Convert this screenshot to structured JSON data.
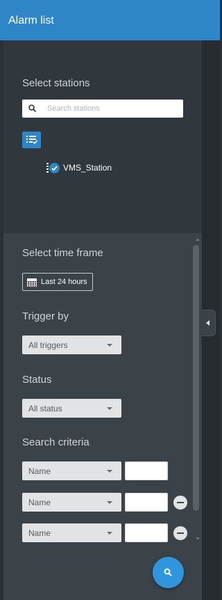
{
  "header": {
    "title": "Alarm list"
  },
  "stations": {
    "section_title": "Select stations",
    "search_placeholder": "Search stations",
    "items": [
      {
        "label": "VMS_Station",
        "checked": true
      }
    ]
  },
  "time_frame": {
    "section_title": "Select time frame",
    "button_label": "Last 24 hours"
  },
  "trigger": {
    "section_title": "Trigger by",
    "selected": "All triggers"
  },
  "status": {
    "section_title": "Status",
    "selected": "All status"
  },
  "criteria": {
    "section_title": "Search criteria",
    "rows": [
      {
        "field": "Name",
        "value": "",
        "removable": false
      },
      {
        "field": "Name",
        "value": "",
        "removable": true
      },
      {
        "field": "Name",
        "value": "",
        "removable": true
      }
    ]
  },
  "colors": {
    "accent": "#2f86c6",
    "header_bg": "#2f86c6",
    "panel_bg": "#30373d",
    "lower_bg": "#3b4348"
  },
  "icons": {
    "search": "search-icon",
    "list": "list-check-icon",
    "calendar": "calendar-icon",
    "collapse": "chevron-left-icon",
    "minus": "minus-icon"
  }
}
